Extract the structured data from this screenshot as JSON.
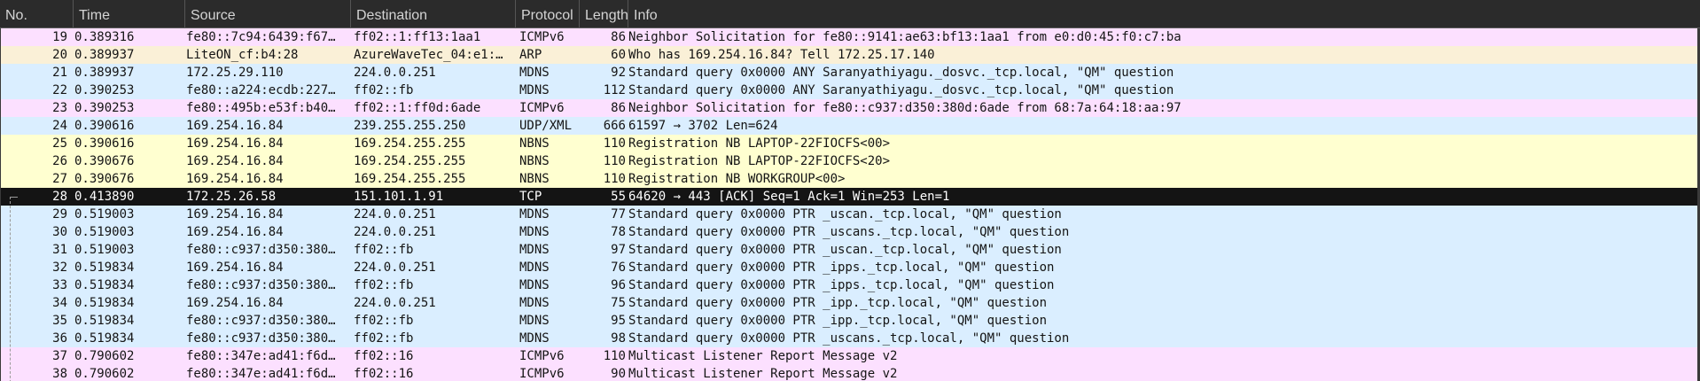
{
  "columns": {
    "no": "No.",
    "time": "Time",
    "source": "Source",
    "destination": "Destination",
    "protocol": "Protocol",
    "length": "Length",
    "info": "Info"
  },
  "selected_packet": "28",
  "colors": {
    "icmpv6": "#fce0ff",
    "arp": "#faf0d7",
    "udp_mdns": "#daeeff",
    "nbns": "#ffffd0",
    "selected": "#141414"
  },
  "packets": [
    {
      "no": "19",
      "time": "0.389316",
      "source": "fe80::7c94:6439:f67…",
      "destination": "ff02::1:ff13:1aa1",
      "protocol": "ICMPv6",
      "length": "86",
      "info": "Neighbor Solicitation for fe80::9141:ae63:bf13:1aa1 from e0:d0:45:f0:c7:ba",
      "color": "icmpv6"
    },
    {
      "no": "20",
      "time": "0.389937",
      "source": "LiteON_cf:b4:28",
      "destination": "AzureWaveTec_04:e1:…",
      "protocol": "ARP",
      "length": "60",
      "info": "Who has 169.254.16.84? Tell 172.25.17.140",
      "color": "arp"
    },
    {
      "no": "21",
      "time": "0.389937",
      "source": "172.25.29.110",
      "destination": "224.0.0.251",
      "protocol": "MDNS",
      "length": "92",
      "info": "Standard query 0x0000 ANY Saranyathiyagu._dosvc._tcp.local, \"QM\" question",
      "color": "udp"
    },
    {
      "no": "22",
      "time": "0.390253",
      "source": "fe80::a224:ecdb:227…",
      "destination": "ff02::fb",
      "protocol": "MDNS",
      "length": "112",
      "info": "Standard query 0x0000 ANY Saranyathiyagu._dosvc._tcp.local, \"QM\" question",
      "color": "udp"
    },
    {
      "no": "23",
      "time": "0.390253",
      "source": "fe80::495b:e53f:b40…",
      "destination": "ff02::1:ff0d:6ade",
      "protocol": "ICMPv6",
      "length": "86",
      "info": "Neighbor Solicitation for fe80::c937:d350:380d:6ade from 68:7a:64:18:aa:97",
      "color": "icmpv6"
    },
    {
      "no": "24",
      "time": "0.390616",
      "source": "169.254.16.84",
      "destination": "239.255.255.250",
      "protocol": "UDP/XML",
      "length": "666",
      "info": "61597 → 3702 Len=624",
      "color": "udp"
    },
    {
      "no": "25",
      "time": "0.390616",
      "source": "169.254.16.84",
      "destination": "169.254.255.255",
      "protocol": "NBNS",
      "length": "110",
      "info": "Registration NB LAPTOP-22FIOCFS<00>",
      "color": "nbns"
    },
    {
      "no": "26",
      "time": "0.390676",
      "source": "169.254.16.84",
      "destination": "169.254.255.255",
      "protocol": "NBNS",
      "length": "110",
      "info": "Registration NB LAPTOP-22FIOCFS<20>",
      "color": "nbns"
    },
    {
      "no": "27",
      "time": "0.390676",
      "source": "169.254.16.84",
      "destination": "169.254.255.255",
      "protocol": "NBNS",
      "length": "110",
      "info": "Registration NB WORKGROUP<00>",
      "color": "nbns"
    },
    {
      "no": "28",
      "time": "0.413890",
      "source": "172.25.26.58",
      "destination": "151.101.1.91",
      "protocol": "TCP",
      "length": "55",
      "info": "64620 → 443 [ACK] Seq=1 Ack=1 Win=253 Len=1",
      "color": "selected"
    },
    {
      "no": "29",
      "time": "0.519003",
      "source": "169.254.16.84",
      "destination": "224.0.0.251",
      "protocol": "MDNS",
      "length": "77",
      "info": "Standard query 0x0000 PTR _uscan._tcp.local, \"QM\" question",
      "color": "udp"
    },
    {
      "no": "30",
      "time": "0.519003",
      "source": "169.254.16.84",
      "destination": "224.0.0.251",
      "protocol": "MDNS",
      "length": "78",
      "info": "Standard query 0x0000 PTR _uscans._tcp.local, \"QM\" question",
      "color": "udp"
    },
    {
      "no": "31",
      "time": "0.519003",
      "source": "fe80::c937:d350:380…",
      "destination": "ff02::fb",
      "protocol": "MDNS",
      "length": "97",
      "info": "Standard query 0x0000 PTR _uscan._tcp.local, \"QM\" question",
      "color": "udp"
    },
    {
      "no": "32",
      "time": "0.519834",
      "source": "169.254.16.84",
      "destination": "224.0.0.251",
      "protocol": "MDNS",
      "length": "76",
      "info": "Standard query 0x0000 PTR _ipps._tcp.local, \"QM\" question",
      "color": "udp"
    },
    {
      "no": "33",
      "time": "0.519834",
      "source": "fe80::c937:d350:380…",
      "destination": "ff02::fb",
      "protocol": "MDNS",
      "length": "96",
      "info": "Standard query 0x0000 PTR _ipps._tcp.local, \"QM\" question",
      "color": "udp"
    },
    {
      "no": "34",
      "time": "0.519834",
      "source": "169.254.16.84",
      "destination": "224.0.0.251",
      "protocol": "MDNS",
      "length": "75",
      "info": "Standard query 0x0000 PTR _ipp._tcp.local, \"QM\" question",
      "color": "udp"
    },
    {
      "no": "35",
      "time": "0.519834",
      "source": "fe80::c937:d350:380…",
      "destination": "ff02::fb",
      "protocol": "MDNS",
      "length": "95",
      "info": "Standard query 0x0000 PTR _ipp._tcp.local, \"QM\" question",
      "color": "udp"
    },
    {
      "no": "36",
      "time": "0.519834",
      "source": "fe80::c937:d350:380…",
      "destination": "ff02::fb",
      "protocol": "MDNS",
      "length": "98",
      "info": "Standard query 0x0000 PTR _uscans._tcp.local, \"QM\" question",
      "color": "udp"
    },
    {
      "no": "37",
      "time": "0.790602",
      "source": "fe80::347e:ad41:f6d…",
      "destination": "ff02::16",
      "protocol": "ICMPv6",
      "length": "110",
      "info": "Multicast Listener Report Message v2",
      "color": "icmpv6"
    },
    {
      "no": "38",
      "time": "0.790602",
      "source": "fe80::347e:ad41:f6d…",
      "destination": "ff02::16",
      "protocol": "ICMPv6",
      "length": "90",
      "info": "Multicast Listener Report Message v2",
      "color": "icmpv6"
    }
  ]
}
